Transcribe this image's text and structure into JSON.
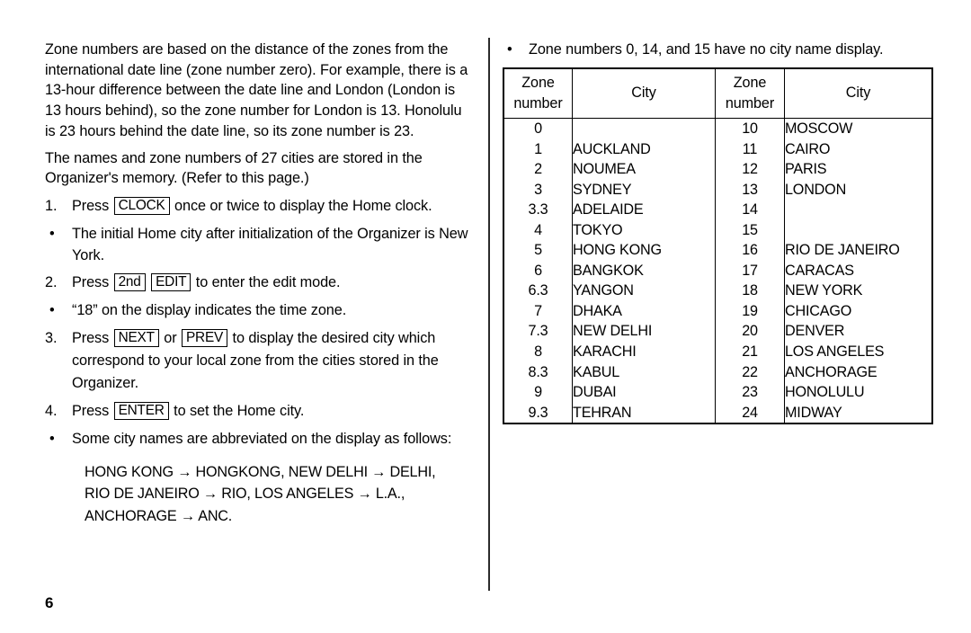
{
  "page": {
    "number": "6"
  },
  "left_column": {
    "paragraphs": [
      "Zone numbers are based on the distance of the zones from the international date line (zone number zero). For example, there is a 13-hour difference between the date line and London (London is 13 hours behind), so the zone number for London is 13. Honolulu is 23 hours behind the date line, so its zone number is 23.",
      "The names and zone numbers of 27 cities are stored in the Organizer's memory. (Refer to this page.)"
    ],
    "steps": [
      {
        "marker": "1.",
        "text_before": "Press",
        "keys": [
          "CLOCK"
        ],
        "text_after": "once or twice to display the Home clock."
      },
      {
        "marker": "•",
        "text_before": "The initial Home city after initialization of the Organizer is New York.",
        "keys": [],
        "text_after": ""
      },
      {
        "marker": "2.",
        "text_before": "Press",
        "keys": [
          "2nd",
          "EDIT"
        ],
        "text_after": "to enter the edit mode."
      },
      {
        "marker": "•",
        "text_before": "“18” on the display indicates the time zone.",
        "keys": [],
        "text_after": ""
      },
      {
        "marker": "3.",
        "text_before": "Press",
        "keys": [
          "NEXT",
          "PREV"
        ],
        "key_separator": "or",
        "text_after": "to display the desired city which correspond to your local zone from the cities stored in the Organizer."
      },
      {
        "marker": "4.",
        "text_before": "Press",
        "keys": [
          "ENTER"
        ],
        "text_after": "to set the Home city."
      },
      {
        "marker": "•",
        "text_before": "Some city names are abbreviated on the display as follows:",
        "keys": [],
        "text_after": ""
      }
    ],
    "abbreviations": [
      "HONG KONG → HONGKONG, NEW DELHI → DELHI,",
      "RIO DE JANEIRO → RIO, LOS ANGELES → L.A.,",
      "ANCHORAGE → ANC."
    ]
  },
  "right_column": {
    "note": {
      "marker": "•",
      "text": "Zone numbers 0, 14, and 15 have no city name display."
    },
    "table": {
      "headers": {
        "zone_line1": "Zone",
        "zone_line2": "number",
        "city": "City"
      },
      "rows": [
        {
          "zone_left": "0",
          "city_left": "",
          "zone_right": "10",
          "city_right": "MOSCOW"
        },
        {
          "zone_left": "1",
          "city_left": "AUCKLAND",
          "zone_right": "11",
          "city_right": "CAIRO"
        },
        {
          "zone_left": "2",
          "city_left": "NOUMEA",
          "zone_right": "12",
          "city_right": "PARIS"
        },
        {
          "zone_left": "3",
          "city_left": "SYDNEY",
          "zone_right": "13",
          "city_right": "LONDON"
        },
        {
          "zone_left": "3.3",
          "city_left": "ADELAIDE",
          "zone_right": "14",
          "city_right": ""
        },
        {
          "zone_left": "4",
          "city_left": "TOKYO",
          "zone_right": "15",
          "city_right": ""
        },
        {
          "zone_left": "5",
          "city_left": "HONG KONG",
          "zone_right": "16",
          "city_right": "RIO DE JANEIRO"
        },
        {
          "zone_left": "6",
          "city_left": "BANGKOK",
          "zone_right": "17",
          "city_right": "CARACAS"
        },
        {
          "zone_left": "6.3",
          "city_left": "YANGON",
          "zone_right": "18",
          "city_right": "NEW YORK"
        },
        {
          "zone_left": "7",
          "city_left": "DHAKA",
          "zone_right": "19",
          "city_right": "CHICAGO"
        },
        {
          "zone_left": "7.3",
          "city_left": "NEW DELHI",
          "zone_right": "20",
          "city_right": "DENVER"
        },
        {
          "zone_left": "8",
          "city_left": "KARACHI",
          "zone_right": "21",
          "city_right": "LOS ANGELES"
        },
        {
          "zone_left": "8.3",
          "city_left": "KABUL",
          "zone_right": "22",
          "city_right": "ANCHORAGE"
        },
        {
          "zone_left": "9",
          "city_left": "DUBAI",
          "zone_right": "23",
          "city_right": "HONOLULU"
        },
        {
          "zone_left": "9.3",
          "city_left": "TEHRAN",
          "zone_right": "24",
          "city_right": "MIDWAY"
        }
      ]
    }
  }
}
